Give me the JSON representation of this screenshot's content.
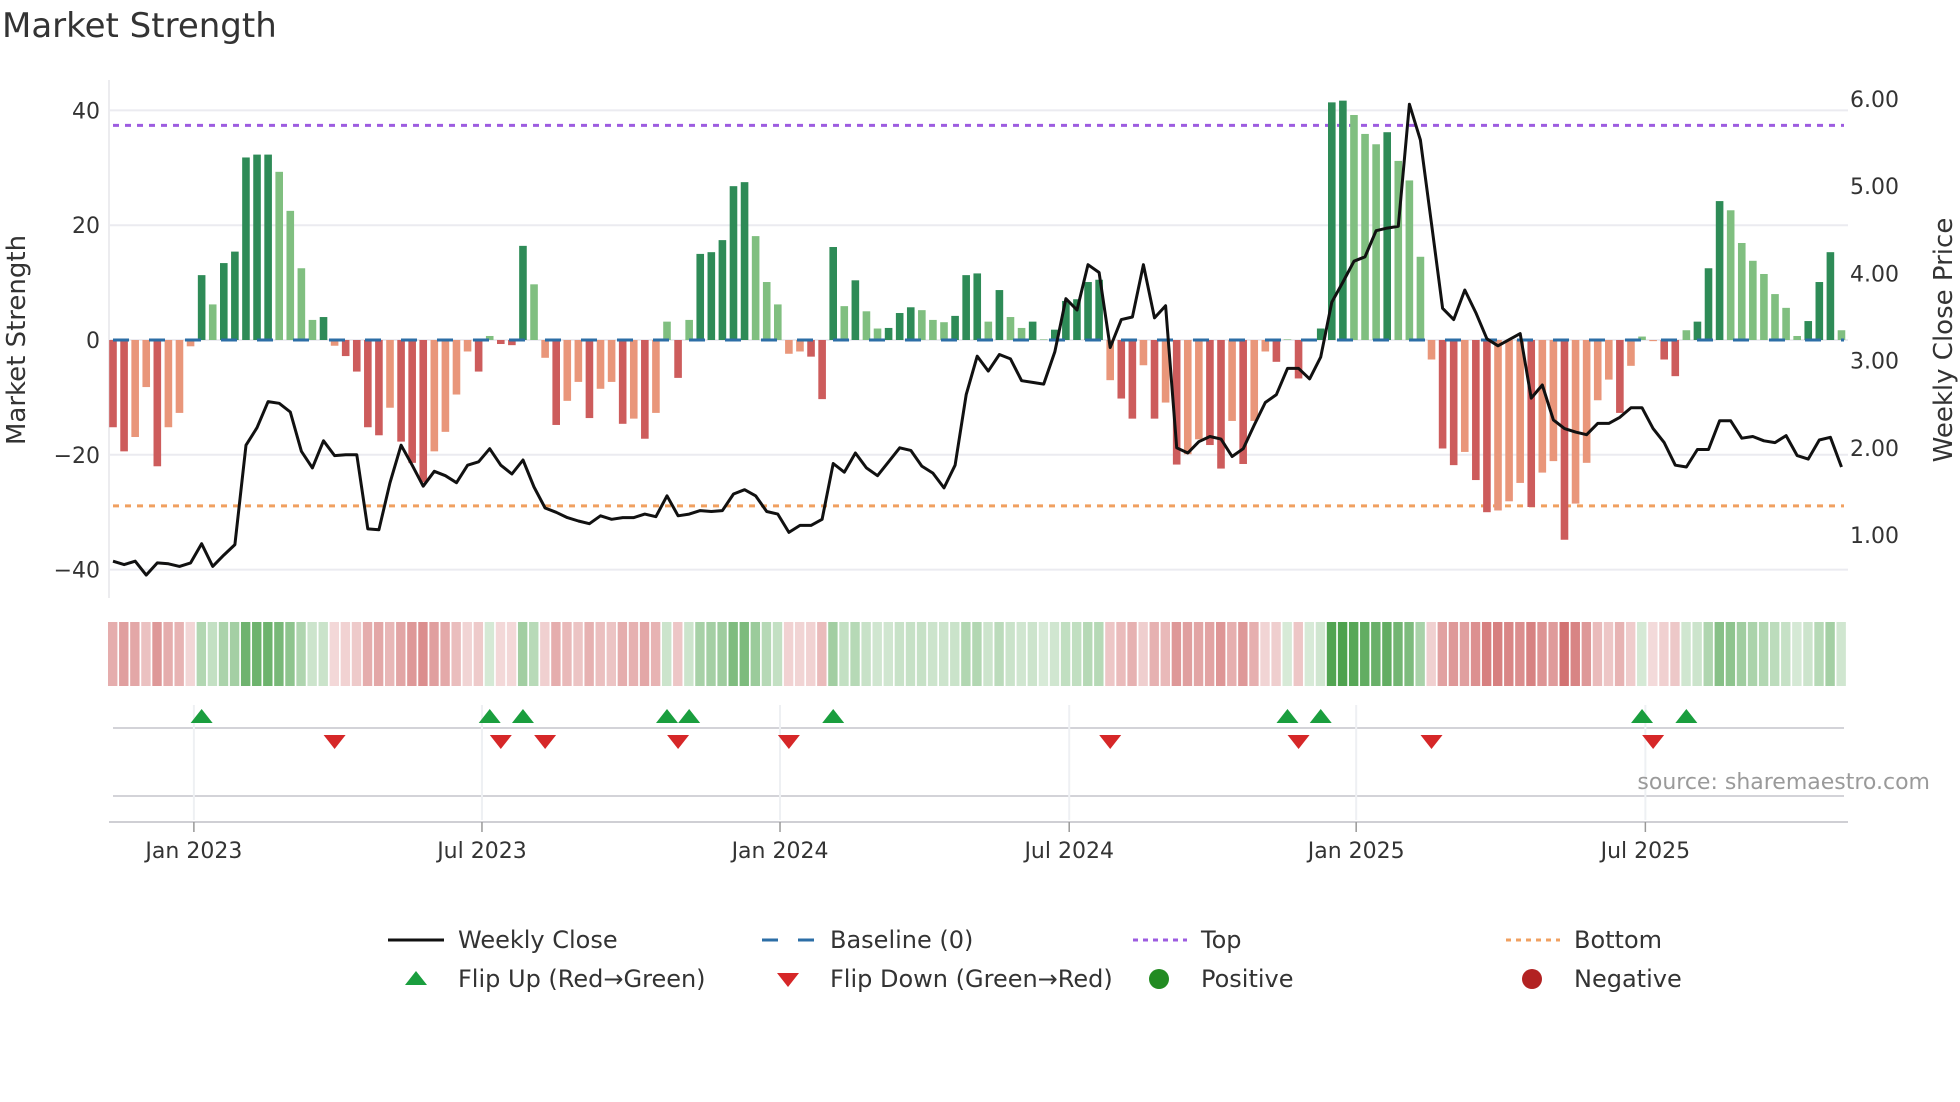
{
  "title": "Market Strength",
  "source": "source: sharemaestro.com",
  "colors": {
    "pos_strong": "#2e8b57",
    "pos_weak": "#80bf80",
    "neg_strong": "#cd5c5c",
    "neg_weak": "#e9967a",
    "heat_pos": "34,139,34",
    "heat_neg": "190,50,50",
    "baseline": "#2c6ea6",
    "top": "#9d5ce0",
    "bottom": "#f0a060",
    "close": "#111111",
    "flip_up": "#1a9e3e",
    "flip_down": "#d62728",
    "positive": "#228b22",
    "negative": "#b22222"
  },
  "legend": [
    {
      "label": "Weekly Close",
      "symbol": "line"
    },
    {
      "label": "Baseline (0)",
      "symbol": "dash"
    },
    {
      "label": "Top",
      "symbol": "dot-purple"
    },
    {
      "label": "Bottom",
      "symbol": "dot-orange"
    },
    {
      "label": "Flip Up (Red→Green)",
      "symbol": "triangle-up"
    },
    {
      "label": "Flip Down (Green→Red)",
      "symbol": "triangle-down"
    },
    {
      "label": "Positive",
      "symbol": "circle-green"
    },
    {
      "label": "Negative",
      "symbol": "circle-red"
    }
  ],
  "chart_data": {
    "type": "bar",
    "title": "Market Strength",
    "ylabel": "Market Strength",
    "y2label": "Weekly Close Price",
    "ylim": [
      -44,
      45
    ],
    "y2lim": [
      0.56,
      6.37
    ],
    "grid": true,
    "legend_position": "bottom",
    "left_ticks": [
      {
        "value": 40,
        "label": "40"
      },
      {
        "value": 20,
        "label": "20"
      },
      {
        "value": 0,
        "label": "0"
      },
      {
        "value": -20,
        "label": "−20"
      },
      {
        "value": -40,
        "label": "−40"
      }
    ],
    "right_ticks": [
      {
        "value": 6,
        "label": "6.00"
      },
      {
        "value": 5,
        "label": "5.00"
      },
      {
        "value": 4,
        "label": "4.00"
      },
      {
        "value": 3,
        "label": "3.00"
      },
      {
        "value": 2,
        "label": "2.00"
      },
      {
        "value": 1,
        "label": "1.00"
      }
    ],
    "x_ticks": [
      {
        "week": 7.3,
        "label": "Jan 2023"
      },
      {
        "week": 33.3,
        "label": "Jul 2023"
      },
      {
        "week": 60.2,
        "label": "Jan 2024"
      },
      {
        "week": 86.3,
        "label": "Jul 2024"
      },
      {
        "week": 112.2,
        "label": "Jan 2025"
      },
      {
        "week": 138.3,
        "label": "Jul 2025"
      }
    ],
    "top_level": 37.4,
    "bottom_level": -28.9,
    "baseline": 0,
    "strength": [
      -15.2,
      -19.4,
      -16.9,
      -8.2,
      -22,
      -15.2,
      -12.7,
      -1.1,
      11.3,
      6.2,
      13.4,
      15.4,
      31.8,
      32.3,
      32.3,
      29.3,
      22.5,
      12.5,
      3.5,
      4.0,
      -1,
      -2.8,
      -5.5,
      -15.2,
      -16.6,
      -11.8,
      -17.7,
      -21.4,
      -24.8,
      -19.4,
      -16,
      -9.5,
      -2,
      -5.5,
      0.7,
      -0.7,
      -0.9,
      16.4,
      9.7,
      -3.1,
      -14.8,
      -10.6,
      -7.3,
      -13.6,
      -8.5,
      -7.3,
      -14.6,
      -13.7,
      -17.2,
      -12.7,
      3.2,
      -6.6,
      3.5,
      15,
      15.3,
      17.4,
      26.8,
      27.5,
      18.1,
      10.1,
      6.2,
      -2.4,
      -2,
      -2.9,
      -10.3,
      16.2,
      5.9,
      10.4,
      5.0,
      2.0,
      2.1,
      4.7,
      5.7,
      5.2,
      3.5,
      3.1,
      4.2,
      11.3,
      11.6,
      3.2,
      8.7,
      4.0,
      2.1,
      3.2,
      0.1,
      1.8,
      6.8,
      7.1,
      10.1,
      10.5,
      -7.0,
      -10.2,
      -13.7,
      -4.4,
      -13.7,
      -10.9,
      -21.7,
      -19.9,
      -17.3,
      -18.3,
      -22.4,
      -14.1,
      -21.6,
      -14.1,
      -2,
      -3.8,
      0.1,
      -6.7,
      0,
      2,
      41.4,
      41.7,
      39.2,
      35.9,
      34.1,
      36.2,
      31.2,
      27.8,
      14.5,
      -3.4,
      -18.9,
      -21.8,
      -19.5,
      -24.4,
      -30,
      -29.7,
      -28.1,
      -24.9,
      -29.1,
      -23.1,
      -21.1,
      -34.8,
      -28.5,
      -21.4,
      -10.5,
      -6.9,
      -12.7,
      -4.5,
      0.6,
      -0.2,
      -3.4,
      -6.3,
      1.7,
      3.2,
      12.5,
      24.2,
      22.6,
      16.9,
      13.8,
      11.5,
      8,
      5.6,
      0.7,
      3.3,
      10.1,
      15.3,
      1.7
    ],
    "close": [
      0.7,
      0.66,
      0.7,
      0.54,
      0.68,
      0.67,
      0.64,
      0.68,
      0.9,
      0.64,
      0.77,
      0.89,
      2.03,
      2.23,
      2.53,
      2.51,
      2.41,
      1.96,
      1.77,
      2.08,
      1.91,
      1.92,
      1.92,
      1.07,
      1.06,
      1.6,
      2.03,
      1.8,
      1.56,
      1.73,
      1.68,
      1.6,
      1.8,
      1.84,
      1.99,
      1.8,
      1.7,
      1.86,
      1.55,
      1.31,
      1.26,
      1.2,
      1.16,
      1.13,
      1.22,
      1.18,
      1.2,
      1.2,
      1.24,
      1.21,
      1.45,
      1.22,
      1.24,
      1.28,
      1.27,
      1.28,
      1.47,
      1.52,
      1.45,
      1.27,
      1.24,
      1.03,
      1.11,
      1.11,
      1.18,
      1.82,
      1.72,
      1.94,
      1.77,
      1.68,
      1.84,
      2.0,
      1.97,
      1.79,
      1.71,
      1.54,
      1.8,
      2.61,
      3.05,
      2.88,
      3.07,
      3.02,
      2.77,
      2.75,
      2.73,
      3.1,
      3.71,
      3.58,
      4.1,
      4.01,
      3.15,
      3.47,
      3.5,
      4.1,
      3.49,
      3.63,
      2.0,
      1.94,
      2.07,
      2.13,
      2.1,
      1.9,
      1.99,
      2.26,
      2.52,
      2.61,
      2.91,
      2.91,
      2.79,
      3.04,
      3.67,
      3.9,
      4.14,
      4.19,
      4.49,
      4.52,
      4.54,
      5.94,
      5.53,
      4.57,
      3.6,
      3.47,
      3.81,
      3.55,
      3.25,
      3.17,
      3.24,
      3.31,
      2.57,
      2.72,
      2.32,
      2.22,
      2.18,
      2.15,
      2.28,
      2.28,
      2.35,
      2.46,
      2.46,
      2.22,
      2.06,
      1.8,
      1.78,
      1.98,
      1.98,
      2.31,
      2.31,
      2.11,
      2.13,
      2.08,
      2.06,
      2.14,
      1.91,
      1.87,
      2.09,
      2.12,
      1.78
    ],
    "flip_up_weeks": [
      8,
      34,
      37,
      50,
      52,
      65,
      106,
      109,
      138,
      142
    ],
    "flip_down_weeks": [
      20,
      35,
      39,
      51,
      61,
      90,
      107,
      119,
      139
    ]
  }
}
